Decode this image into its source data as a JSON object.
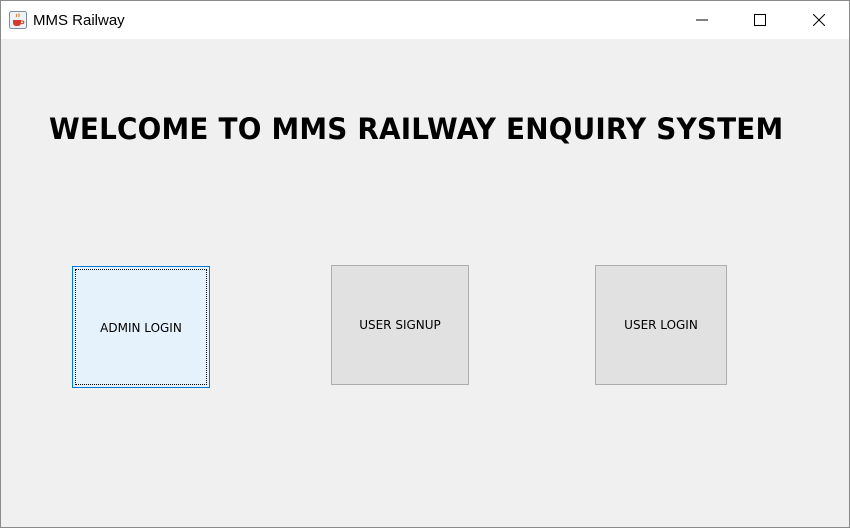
{
  "window": {
    "title": "MMS Railway",
    "icons": {
      "app": "java-coffee-cup-icon",
      "minimize": "minimize-icon",
      "maximize": "maximize-icon",
      "close": "close-icon"
    }
  },
  "main": {
    "heading": "WELCOME TO MMS RAILWAY ENQUIRY SYSTEM",
    "buttons": {
      "admin_login": "ADMIN LOGIN",
      "user_signup": "USER SIGNUP",
      "user_login": "USER LOGIN"
    }
  },
  "colors": {
    "background": "#f0f0f0",
    "button_face": "#e1e1e1",
    "focused_button_face": "#e5f1fb",
    "focus_border": "#0078d7"
  }
}
